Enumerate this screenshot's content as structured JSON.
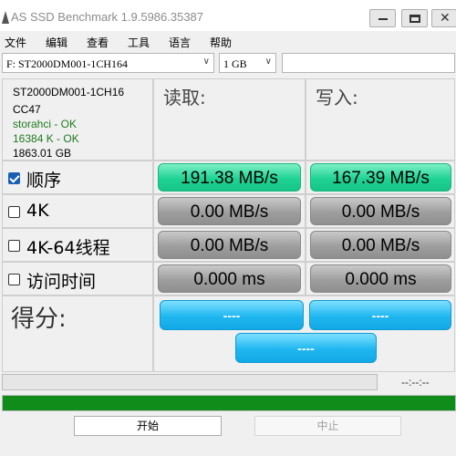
{
  "window": {
    "title": "AS SSD Benchmark 1.9.5986.35387",
    "close_glyph": "✕"
  },
  "menu": [
    "文件",
    "编辑",
    "查看",
    "工具",
    "语言",
    "帮助"
  ],
  "selectors": {
    "drive": "F: ST2000DM001-1CH164",
    "size": "1 GB",
    "extra": ""
  },
  "drive_info": {
    "model": "ST2000DM001-1CH16",
    "firmware": "CC47",
    "driver": "storahci - OK",
    "alignment": "16384 K - OK",
    "capacity": "1863.01 GB"
  },
  "headers": {
    "read": "读取:",
    "write": "写入:"
  },
  "tests": [
    {
      "label": "顺序",
      "checked": true,
      "read": "191.38 MB/s",
      "write": "167.39 MB/s",
      "style": "green"
    },
    {
      "label": "4K",
      "checked": false,
      "read": "0.00 MB/s",
      "write": "0.00 MB/s",
      "style": "gray"
    },
    {
      "label": "4K-64线程",
      "checked": false,
      "read": "0.00 MB/s",
      "write": "0.00 MB/s",
      "style": "gray"
    },
    {
      "label": "访问时间",
      "checked": false,
      "read": "0.000 ms",
      "write": "0.000 ms",
      "style": "gray"
    }
  ],
  "score": {
    "label": "得分:",
    "read": "----",
    "write": "----",
    "total": "----"
  },
  "progress": {
    "time": "--:--:--",
    "main_fraction": 1.0
  },
  "buttons": {
    "start": "开始",
    "stop": "中止"
  },
  "colors": {
    "green_pill": "#1fd395",
    "gray_pill": "#9e9e9e",
    "blue_pill": "#1fb7f0",
    "progress": "#0f8c1a",
    "ok_text": "#1f7a1f"
  }
}
